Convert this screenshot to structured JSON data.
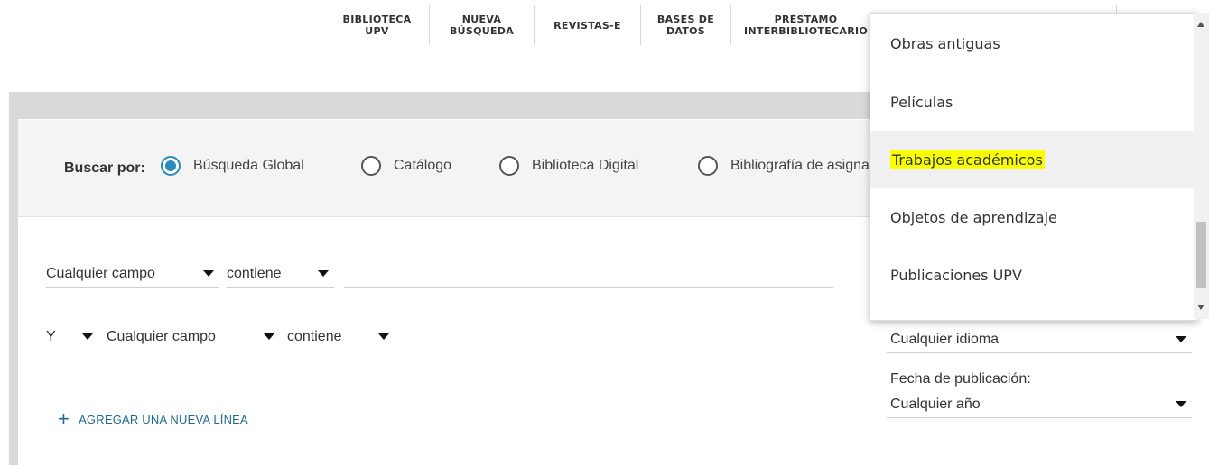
{
  "nav": {
    "items": [
      {
        "label": "BIBLIOTECA\nUPV"
      },
      {
        "label": "NUEVA\nBÚSQUEDA"
      },
      {
        "label": "REVISTAS-E"
      },
      {
        "label": "BASES DE\nDATOS"
      },
      {
        "label": "PRÉSTAMO\nINTERBIBLIOTECARIO"
      }
    ]
  },
  "search_by": {
    "label": "Buscar por:",
    "options": [
      {
        "label": "Búsqueda Global",
        "checked": true
      },
      {
        "label": "Catálogo",
        "checked": false
      },
      {
        "label": "Biblioteca Digital",
        "checked": false
      },
      {
        "label": "Bibliografía de asignaturas",
        "checked": false
      }
    ]
  },
  "query": {
    "line1": {
      "field": "Cualquier campo",
      "operator": "contiene",
      "value": ""
    },
    "line2": {
      "boolean": "Y",
      "field": "Cualquier campo",
      "operator": "contiene",
      "value": ""
    },
    "add_line_label": "AGREGAR UNA NUEVA LÍNEA"
  },
  "filters": {
    "language_value": "Cualquier idioma",
    "date_label": "Fecha de publicación:",
    "date_value": "Cualquier año"
  },
  "dropdown": {
    "items": [
      {
        "label": "Obras antiguas",
        "highlighted": false
      },
      {
        "label": "Películas",
        "highlighted": false
      },
      {
        "label": "Trabajos académicos",
        "highlighted": true
      },
      {
        "label": "Objetos de aprendizaje",
        "highlighted": false
      },
      {
        "label": "Publicaciones UPV",
        "highlighted": false
      }
    ]
  },
  "colors": {
    "accent": "#2a8bb8",
    "link": "#1f6a91",
    "highlight": "#faff00",
    "band": "#d9d9d9"
  }
}
